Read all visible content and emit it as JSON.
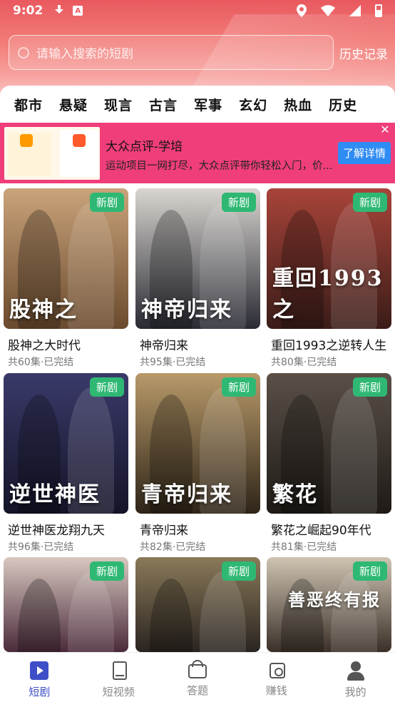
{
  "status_bar": {
    "time": "9:02",
    "a_icon_letter": "A"
  },
  "search": {
    "placeholder": "请输入搜索的短剧",
    "history_label": "历史记录"
  },
  "categories": [
    "都市",
    "悬疑",
    "现言",
    "古言",
    "军事",
    "玄幻",
    "热血",
    "历史"
  ],
  "ad": {
    "title": "大众点评-学培",
    "description": "运动项目一网打尽，大众点评带你轻松入门，价...",
    "cta_label": "了解详情",
    "close_label": "✕"
  },
  "badge_label": "新剧",
  "dramas": [
    {
      "title": "股神之大时代",
      "meta": "共60集·已完结",
      "poster_text": "股神之",
      "colors": [
        "#c9a37a",
        "#6a4a2e"
      ]
    },
    {
      "title": "神帝归来",
      "meta": "共95集·已完结",
      "poster_text": "神帝归来",
      "colors": [
        "#d9d6d0",
        "#2a2a34"
      ]
    },
    {
      "title": "重回1993之逆转人生",
      "meta": "共80集·已完结",
      "poster_text": "重回1993之",
      "colors": [
        "#a8443a",
        "#3a1c18"
      ]
    },
    {
      "title": "逆世神医龙翔九天",
      "meta": "共96集·已完结",
      "poster_text": "逆世神医",
      "colors": [
        "#3a3a6a",
        "#141428"
      ]
    },
    {
      "title": "青帝归来",
      "meta": "共82集·已完结",
      "poster_text": "青帝归来",
      "colors": [
        "#b89a6a",
        "#2e2418"
      ]
    },
    {
      "title": "繁花之崛起90年代",
      "meta": "共81集·已完结",
      "poster_text": "繁花",
      "colors": [
        "#5a5048",
        "#1e1a16"
      ]
    },
    {
      "title": "",
      "meta": "",
      "poster_text": "",
      "colors": [
        "#d8c8c0",
        "#4a2a3a"
      ]
    },
    {
      "title": "",
      "meta": "",
      "poster_text": "",
      "colors": [
        "#8a7a5a",
        "#2a2420"
      ]
    },
    {
      "title": "",
      "meta": "",
      "poster_text": "善恶终有报",
      "colors": [
        "#cfc4b2",
        "#3a3028"
      ]
    }
  ],
  "bottom_nav": [
    {
      "label": "短剧",
      "icon": "play-icon",
      "active": true
    },
    {
      "label": "短视频",
      "icon": "book-icon",
      "active": false
    },
    {
      "label": "答题",
      "icon": "shop-icon",
      "active": false
    },
    {
      "label": "赚钱",
      "icon": "calendar-icon",
      "active": false
    },
    {
      "label": "我的",
      "icon": "user-icon",
      "active": false
    }
  ]
}
